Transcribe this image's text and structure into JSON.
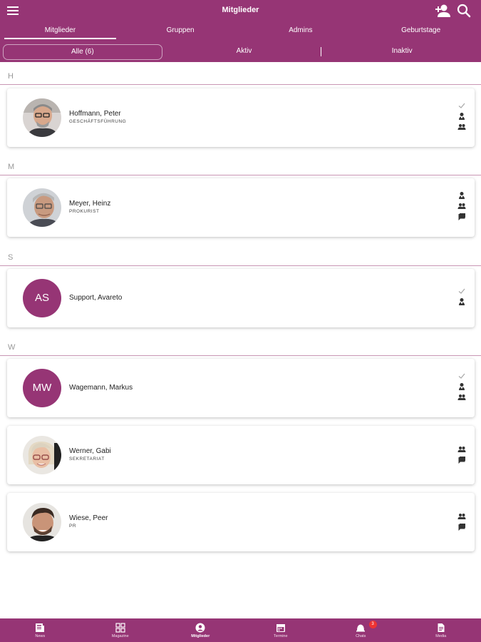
{
  "header": {
    "title": "Mitglieder",
    "tabs": [
      "Mitglieder",
      "Gruppen",
      "Admins",
      "Geburtstage"
    ],
    "filters": [
      "Alle (6)",
      "Aktiv",
      "Inaktiv"
    ]
  },
  "sections": [
    {
      "letter": "H",
      "members": [
        {
          "name": "Hoffmann, Peter",
          "role": "GESCHÄFTSFÜHRUNG",
          "icons": [
            "check-icon",
            "admin-icon",
            "group-icon"
          ]
        }
      ]
    },
    {
      "letter": "M",
      "members": [
        {
          "name": "Meyer, Heinz",
          "role": "PROKURIST",
          "icons": [
            "admin-icon",
            "group-icon",
            "chat-icon"
          ]
        }
      ]
    },
    {
      "letter": "S",
      "members": [
        {
          "name": "Support, Avareto",
          "initials": "AS",
          "icons": [
            "check-icon",
            "admin-icon"
          ]
        }
      ]
    },
    {
      "letter": "W",
      "members": [
        {
          "name": "Wagemann, Markus",
          "initials": "MW",
          "icons": [
            "check-icon",
            "admin-icon",
            "group-icon"
          ]
        },
        {
          "name": "Werner, Gabi",
          "role": "SEKRETARIAT",
          "icons": [
            "group-icon",
            "chat-icon"
          ]
        },
        {
          "name": "Wiese, Peer",
          "role": "PR",
          "icons": [
            "group-icon",
            "chat-icon"
          ]
        }
      ]
    }
  ],
  "bottom_nav": [
    {
      "label": "News",
      "icon": "news-icon"
    },
    {
      "label": "Magazine",
      "icon": "grid-icon"
    },
    {
      "label": "Mitglieder",
      "icon": "person-icon"
    },
    {
      "label": "Termine",
      "icon": "calendar-icon"
    },
    {
      "label": "Chats",
      "icon": "chat-bell-icon",
      "badge": "3"
    },
    {
      "label": "Media",
      "icon": "document-icon"
    }
  ],
  "colors": {
    "primary": "#963575",
    "section_line": "#c896b4",
    "badge": "#e33333"
  }
}
